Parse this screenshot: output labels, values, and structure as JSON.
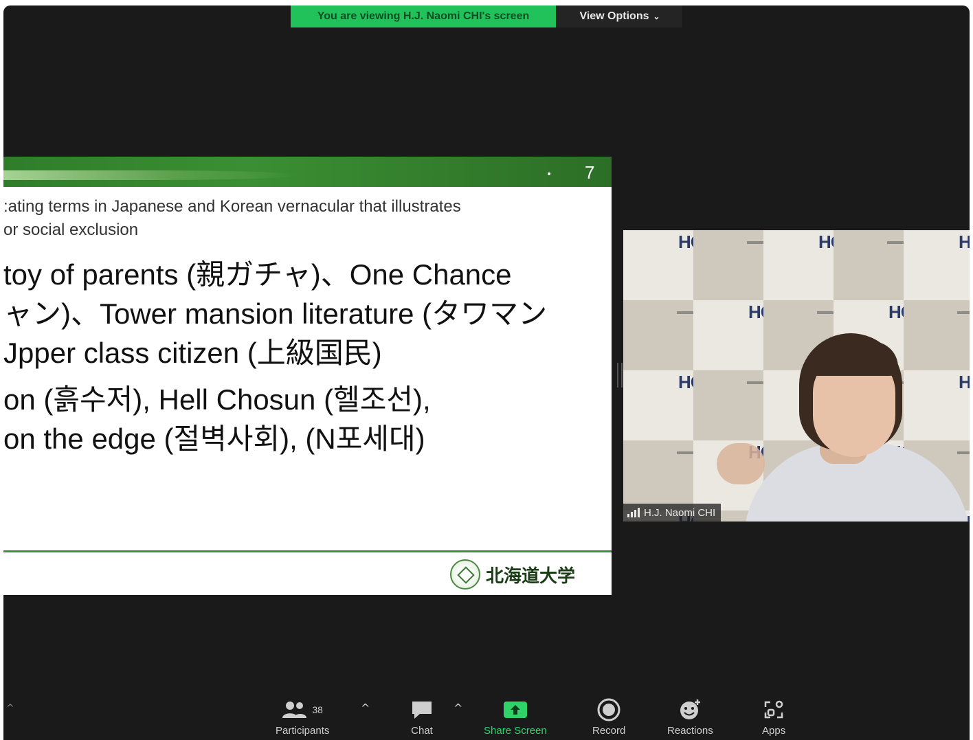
{
  "banner": {
    "viewing_text": "You are viewing H.J. Naomi CHI's screen",
    "view_options_label": "View Options",
    "view_options_icon": "chevron-down-icon"
  },
  "slide": {
    "number": "7",
    "dot": "•",
    "subtitle_lines": [
      ":ating terms in Japanese and Korean vernacular that illustrates",
      " or social exclusion"
    ],
    "body_lines": [
      " toy of parents (親ガチャ)、One Chance",
      "ャン)、Tower mansion literature (タワマン",
      "Jpper class citizen (上級国民)",
      "on (흙수저), Hell Chosun (헬조선),",
      " on the edge (절벽사회), (N포세대)"
    ],
    "logo_text": "北海道大学",
    "header_color": "#3b8f33"
  },
  "video": {
    "participant_name": "H.J. Naomi CHI",
    "backdrop_logo": "HOPS"
  },
  "toolbar": {
    "participants_label": "Participants",
    "participants_count": "38",
    "chat_label": "Chat",
    "share_label": "Share Screen",
    "record_label": "Record",
    "reactions_label": "Reactions",
    "apps_label": "Apps",
    "share_color": "#2fd36a"
  }
}
